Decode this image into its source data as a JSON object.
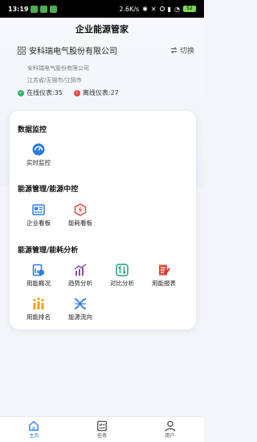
{
  "status_bar": {
    "time": "13:19",
    "speed": "2.6K/s",
    "battery": "52"
  },
  "app_title": "企业能源管家",
  "company": {
    "name": "安科瑞电气股份有限公司",
    "switch_label": "切换",
    "full_name": "安科瑞电气股份有限公司",
    "address": "江苏省/无锡市/江阴市"
  },
  "meters": {
    "online": "在线仪表:35",
    "offline": "离线仪表:27"
  },
  "sections": [
    {
      "title": "数据监控",
      "items": [
        {
          "label": "实时监控",
          "icon": "monitor-icon"
        }
      ]
    },
    {
      "title": "能源管理/能源中控",
      "items": [
        {
          "label": "企业看板",
          "icon": "dashboard-icon"
        },
        {
          "label": "能耗看板",
          "icon": "energy-icon"
        }
      ]
    },
    {
      "title": "能源管理/能耗分析",
      "items": [
        {
          "label": "用能概况",
          "icon": "overview-icon"
        },
        {
          "label": "趋势分析",
          "icon": "trend-icon"
        },
        {
          "label": "对比分析",
          "icon": "compare-icon"
        },
        {
          "label": "用能报表",
          "icon": "report-icon"
        },
        {
          "label": "用能排名",
          "icon": "ranking-icon"
        },
        {
          "label": "能源流向",
          "icon": "flow-icon"
        }
      ]
    }
  ],
  "tabs": [
    {
      "label": "主页",
      "icon": "home-icon"
    },
    {
      "label": "任务",
      "icon": "task-icon"
    },
    {
      "label": "用户",
      "icon": "user-icon"
    }
  ],
  "colors": {
    "primary": "#2f7be0",
    "online": "#34b36b",
    "offline": "#e24a3b"
  }
}
